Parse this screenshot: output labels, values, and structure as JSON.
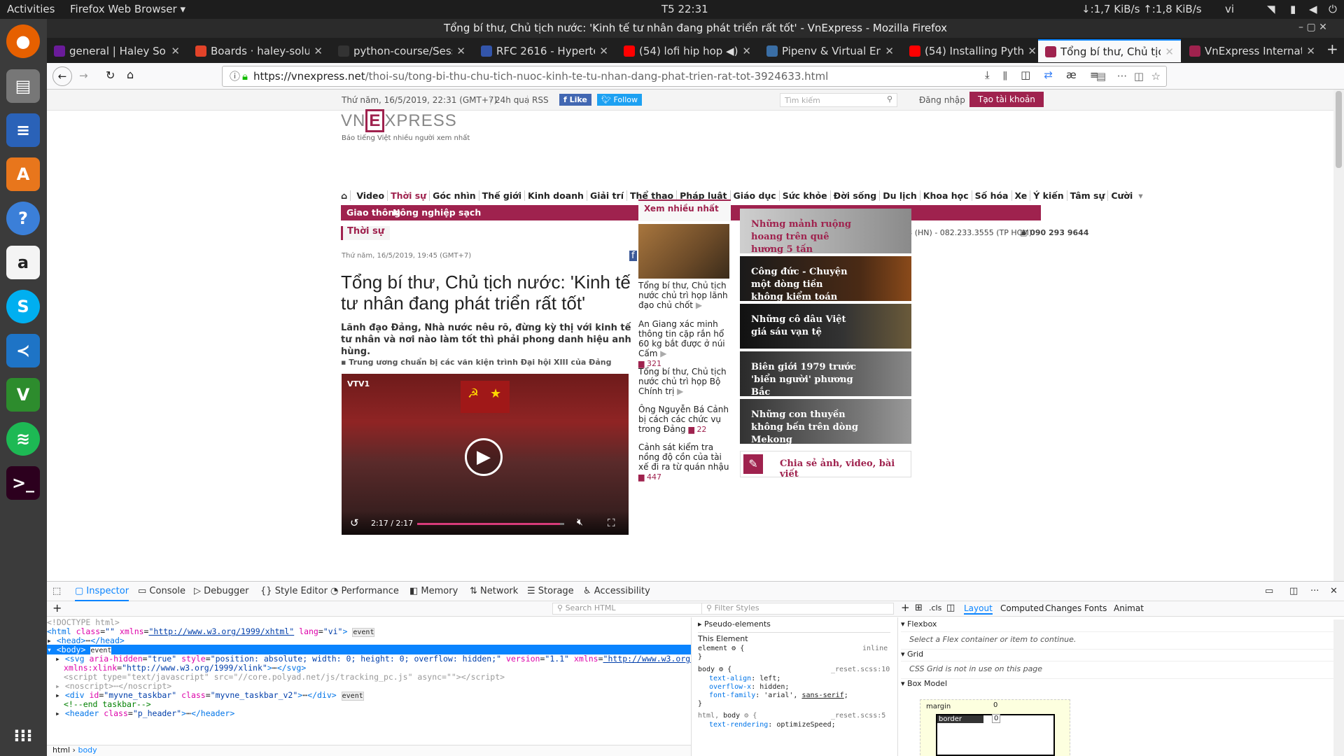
{
  "system": {
    "activities": "Activities",
    "app_menu": "Firefox Web Browser",
    "clock": "T5 22:31",
    "net_speed": "↓:1,7 KiB/s ↑:1,8 KiB/s",
    "lang": "vi"
  },
  "window": {
    "title": "Tổng bí thư, Chủ tịch nước: 'Kinh tế tư nhân đang phát triển rất tốt' - VnExpress - Mozilla Firefox"
  },
  "tabs": [
    {
      "label": "general | Haley Soluti",
      "color": "#6a1b9a"
    },
    {
      "label": "Boards · haley-solutic",
      "color": "#e24329"
    },
    {
      "label": "python-course/Sessio",
      "color": "#333333"
    },
    {
      "label": "RFC 2616 - Hypertext",
      "color": "#3355aa"
    },
    {
      "label": "(54) lofi hip hop ra",
      "color": "#ff0000"
    },
    {
      "label": "Pipenv & Virtual Envir",
      "color": "#3a6ea5"
    },
    {
      "label": "(54) Installing Python",
      "color": "#ff0000"
    },
    {
      "label": "Tổng bí thư, Chủ tịch",
      "color": "#9f224e"
    },
    {
      "label": "VnExpress Internatio",
      "color": "#9f224e"
    }
  ],
  "url": {
    "host": "https://vnexpress.net",
    "path": "/thoi-su/tong-bi-thu-chu-tich-nuoc-kinh-te-tu-nhan-dang-phat-trien-rat-tot-3924633.html"
  },
  "site": {
    "date": "Thứ năm, 16/5/2019, 22:31 (GMT+7)",
    "hours24": "24h qua",
    "rss": "RSS",
    "like": "Like",
    "follow": "Follow",
    "search_placeholder": "Tìm kiếm",
    "login": "Đăng nhập",
    "register": "Tạo tài khoản",
    "logo_tagline": "Báo tiếng Việt nhiều người xem nhất",
    "menu": [
      "Video",
      "Thời sự",
      "Góc nhìn",
      "Thế giới",
      "Kinh doanh",
      "Giải trí",
      "Thể thao",
      "Pháp luật",
      "Giáo dục",
      "Sức khỏe",
      "Đời sống",
      "Du lịch",
      "Khoa học",
      "Số hóa",
      "Xe",
      "Ý kiến",
      "Tâm sự",
      "Cười"
    ],
    "submenu": [
      "Giao thông",
      "Nông nghiệp sạch"
    ],
    "section": "Thời sự",
    "hotline": "083.888.0123 (HN) - 082.233.3555 (TP HCM)",
    "hotline2": "090 293 9644"
  },
  "article": {
    "date": "Thứ năm, 16/5/2019, 19:45 (GMT+7)",
    "title": "Tổng bí thư, Chủ tịch nước: 'Kinh tế tư nhân đang phát triển rất tốt'",
    "lead": "Lãnh đạo Đảng, Nhà nước nêu rõ, đừng kỳ thị với kinh tế tư nhân và nơi nào làm tốt thì phải phong danh hiệu anh hùng.",
    "related": "Trung ương chuẩn bị các văn kiện trình Đại hội XIII của Đảng",
    "video_time": "2:17 / 2:17",
    "video_progress": 0.97
  },
  "most_viewed": {
    "title": "Xem nhiều nhất",
    "items": [
      {
        "text": "Tổng bí thư, Chủ tịch nước chủ trì họp lãnh đạo chủ chốt",
        "comments": ""
      },
      {
        "text": "An Giang xác minh thông tin cặp rắn hổ 60 kg bắt được ở núi Cấm",
        "comments": "321"
      },
      {
        "text": "Tổng bí thư, Chủ tịch nước chủ trì họp Bộ Chính trị",
        "comments": ""
      },
      {
        "text": "Ông Nguyễn Bá Cảnh bị cách các chức vụ trong Đảng",
        "comments": "22"
      },
      {
        "text": "Cảnh sát kiểm tra nồng độ cồn của tài xế đi ra từ quán nhậu",
        "comments": "447"
      }
    ]
  },
  "features": [
    "Những mảnh ruộng hoang trên quê hương 5 tấn",
    "Công đức - Chuyện một dòng tiền không kiểm toán",
    "Những cô dâu Việt giá sáu vạn tệ",
    "Biên giới 1979 trước 'biển người' phương Bắc",
    "Những con thuyền không bến trên dòng Mekong"
  ],
  "share_banner": "Chia sẻ ảnh, video, bài viết",
  "devtools": {
    "tabs": [
      "Inspector",
      "Console",
      "Debugger",
      "Style Editor",
      "Performance",
      "Memory",
      "Network",
      "Storage",
      "Accessibility"
    ],
    "search_html": "Search HTML",
    "filter_styles": "Filter Styles",
    "cls": ".cls",
    "right_tabs": [
      "Layout",
      "Computed",
      "Changes",
      "Fonts",
      "Animat"
    ],
    "pseudo": "Pseudo-elements",
    "this_element": "This Element",
    "flexbox": "Flexbox",
    "flex_hint": "Select a Flex container or item to continue.",
    "grid": "Grid",
    "grid_hint": "CSS Grid is not in use on this page",
    "boxmodel": "Box Model",
    "margin": "margin",
    "border": "border",
    "zero": "0",
    "breadcrumb": [
      "html",
      "body"
    ],
    "reset_file1": "_reset.scss:10",
    "reset_file2": "_reset.scss:5",
    "inline": "inline"
  }
}
